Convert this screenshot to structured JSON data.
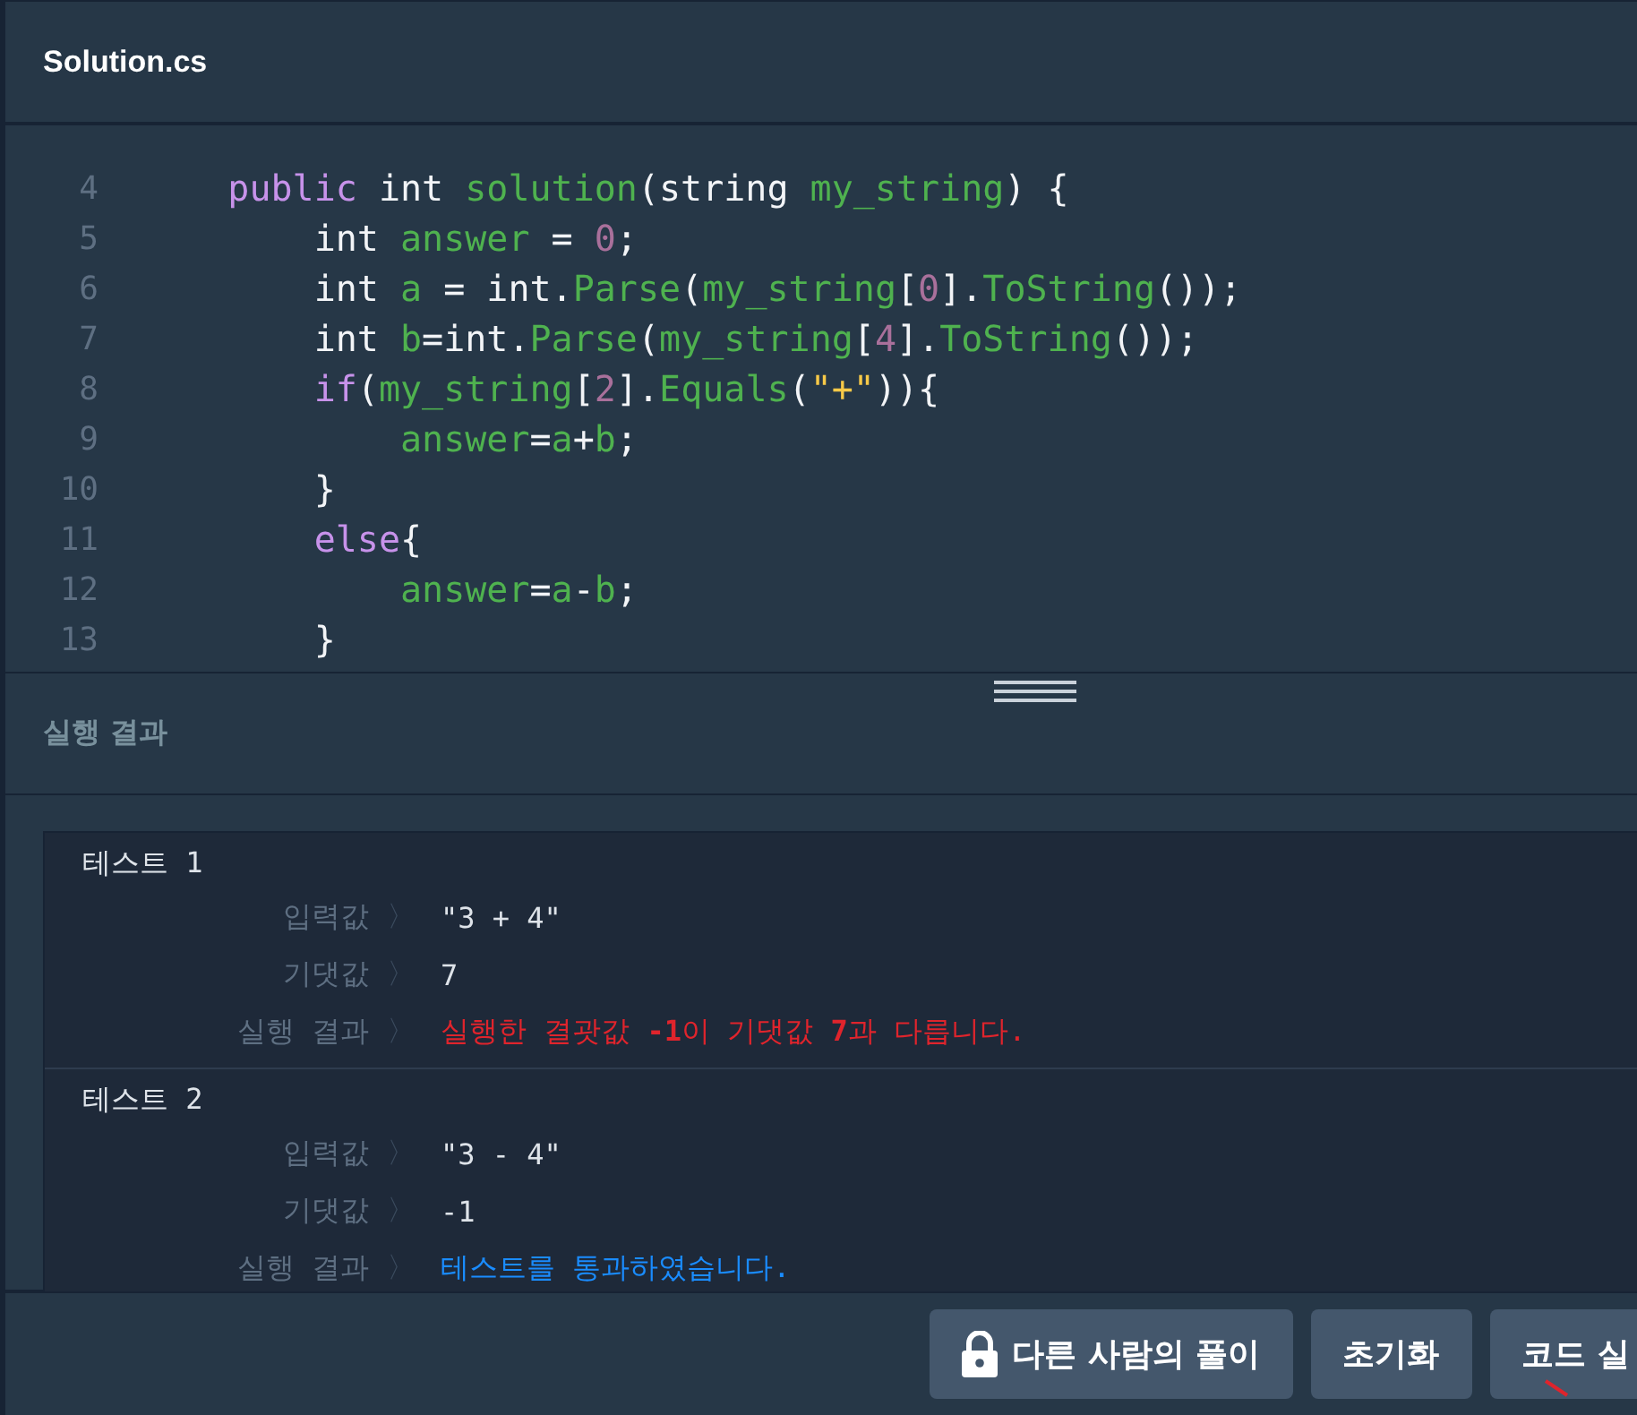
{
  "editor": {
    "filename": "Solution.cs",
    "lines": [
      {
        "number": "4",
        "tokens": [
          {
            "text": "    public",
            "kind": "keyword"
          },
          {
            "text": " int ",
            "kind": "plain"
          },
          {
            "text": "solution",
            "kind": "name"
          },
          {
            "text": "(string ",
            "kind": "plain"
          },
          {
            "text": "my_string",
            "kind": "name"
          },
          {
            "text": ") {",
            "kind": "plain"
          }
        ]
      },
      {
        "number": "5",
        "tokens": [
          {
            "text": "        int ",
            "kind": "plain"
          },
          {
            "text": "answer",
            "kind": "name"
          },
          {
            "text": " = ",
            "kind": "plain"
          },
          {
            "text": "0",
            "kind": "number"
          },
          {
            "text": ";",
            "kind": "plain"
          }
        ]
      },
      {
        "number": "6",
        "tokens": [
          {
            "text": "        int ",
            "kind": "plain"
          },
          {
            "text": "a",
            "kind": "name"
          },
          {
            "text": " = int.",
            "kind": "plain"
          },
          {
            "text": "Parse",
            "kind": "name"
          },
          {
            "text": "(",
            "kind": "plain"
          },
          {
            "text": "my_string",
            "kind": "name"
          },
          {
            "text": "[",
            "kind": "plain"
          },
          {
            "text": "0",
            "kind": "number"
          },
          {
            "text": "].",
            "kind": "plain"
          },
          {
            "text": "ToString",
            "kind": "name"
          },
          {
            "text": "());",
            "kind": "plain"
          }
        ]
      },
      {
        "number": "7",
        "tokens": [
          {
            "text": "        int ",
            "kind": "plain"
          },
          {
            "text": "b",
            "kind": "name"
          },
          {
            "text": "=int.",
            "kind": "plain"
          },
          {
            "text": "Parse",
            "kind": "name"
          },
          {
            "text": "(",
            "kind": "plain"
          },
          {
            "text": "my_string",
            "kind": "name"
          },
          {
            "text": "[",
            "kind": "plain"
          },
          {
            "text": "4",
            "kind": "number"
          },
          {
            "text": "].",
            "kind": "plain"
          },
          {
            "text": "ToString",
            "kind": "name"
          },
          {
            "text": "());",
            "kind": "plain"
          }
        ]
      },
      {
        "number": "8",
        "tokens": [
          {
            "text": "        if",
            "kind": "keyword"
          },
          {
            "text": "(",
            "kind": "plain"
          },
          {
            "text": "my_string",
            "kind": "name"
          },
          {
            "text": "[",
            "kind": "plain"
          },
          {
            "text": "2",
            "kind": "number"
          },
          {
            "text": "].",
            "kind": "plain"
          },
          {
            "text": "Equals",
            "kind": "name"
          },
          {
            "text": "(",
            "kind": "plain"
          },
          {
            "text": "\"+\"",
            "kind": "string"
          },
          {
            "text": ")){",
            "kind": "plain"
          }
        ]
      },
      {
        "number": "9",
        "tokens": [
          {
            "text": "            answer",
            "kind": "name"
          },
          {
            "text": "=",
            "kind": "plain"
          },
          {
            "text": "a",
            "kind": "name"
          },
          {
            "text": "+",
            "kind": "plain"
          },
          {
            "text": "b",
            "kind": "name"
          },
          {
            "text": ";",
            "kind": "plain"
          }
        ]
      },
      {
        "number": "10",
        "tokens": [
          {
            "text": "        }",
            "kind": "plain"
          }
        ]
      },
      {
        "number": "11",
        "tokens": [
          {
            "text": "        else",
            "kind": "keyword"
          },
          {
            "text": "{",
            "kind": "plain"
          }
        ]
      },
      {
        "number": "12",
        "tokens": [
          {
            "text": "            answer",
            "kind": "name"
          },
          {
            "text": "=",
            "kind": "plain"
          },
          {
            "text": "a",
            "kind": "name"
          },
          {
            "text": "-",
            "kind": "plain"
          },
          {
            "text": "b",
            "kind": "name"
          },
          {
            "text": ";",
            "kind": "plain"
          }
        ]
      },
      {
        "number": "13",
        "tokens": [
          {
            "text": "        }",
            "kind": "plain"
          }
        ]
      }
    ]
  },
  "results": {
    "title": "실행 결과",
    "tests": [
      {
        "name": "테스트 1",
        "rows": [
          {
            "label": "입력값",
            "sep": "〉",
            "value": "\"3 + 4\"",
            "kind": "value"
          },
          {
            "label": "기댓값",
            "sep": "〉",
            "value": "7",
            "kind": "value"
          },
          {
            "label": "실행 결과",
            "sep": "〉",
            "value": "실행한 결괏값 **-1**이 기댓값 **7**과 다릅니다.",
            "kind": "fail"
          }
        ]
      },
      {
        "name": "테스트 2",
        "rows": [
          {
            "label": "입력값",
            "sep": "〉",
            "value": "\"3 - 4\"",
            "kind": "value"
          },
          {
            "label": "기댓값",
            "sep": "〉",
            "value": "-1",
            "kind": "value"
          },
          {
            "label": "실행 결과",
            "sep": "〉",
            "value": "테스트를 통과하였습니다.",
            "kind": "pass"
          }
        ]
      }
    ]
  },
  "buttons": [
    {
      "label": "다른 사람의 풀이",
      "kind": "locked"
    },
    {
      "label": "초기화",
      "kind": "plain"
    },
    {
      "label": "코드 실",
      "kind": "plain"
    }
  ]
}
